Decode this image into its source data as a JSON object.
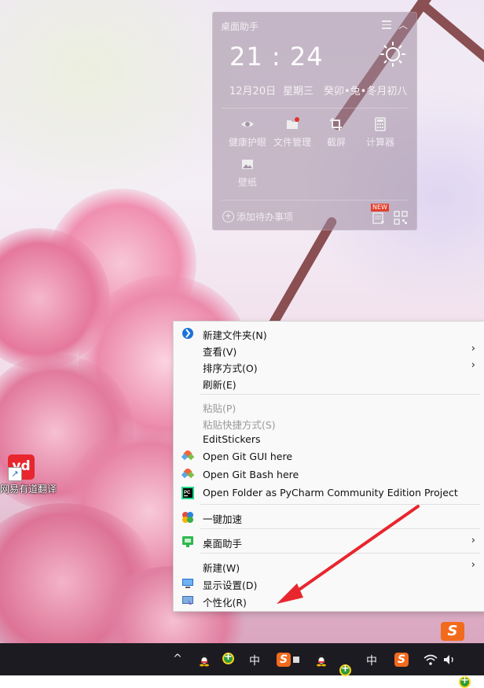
{
  "widget": {
    "title": "桌面助手",
    "time": "21 : 24",
    "date": "12月20日",
    "weekday": "星期三",
    "lunar": "癸卯•兔•冬月初八",
    "tools": [
      {
        "label": "健康护眼",
        "icon": "eye-icon"
      },
      {
        "label": "文件管理",
        "icon": "folder-icon"
      },
      {
        "label": "截屏",
        "icon": "crop-icon"
      },
      {
        "label": "计算器",
        "icon": "calculator-icon"
      },
      {
        "label": "壁纸",
        "icon": "image-icon"
      }
    ],
    "add_todo": "添加待办事项",
    "new_badge": "NEW"
  },
  "desktop_icon": {
    "label": "网易有道翻译",
    "icon_text": "yd"
  },
  "context_menu": {
    "items": [
      {
        "label": "新建文件夹(N)",
        "icon": "new-folder-icon"
      },
      {
        "label": "查看(V)",
        "submenu": true
      },
      {
        "label": "排序方式(O)",
        "submenu": true
      },
      {
        "label": "刷新(E)"
      },
      {
        "label": "粘贴(P)",
        "disabled": true
      },
      {
        "label": "粘贴快捷方式(S)",
        "disabled": true
      },
      {
        "label": "EditStickers"
      },
      {
        "label": "Open Git GUI here",
        "icon": "git-icon"
      },
      {
        "label": "Open Git Bash here",
        "icon": "git-icon"
      },
      {
        "label": "Open Folder as PyCharm Community Edition Project",
        "icon": "pycharm-icon"
      },
      {
        "label": "一键加速",
        "icon": "accelerate-icon"
      },
      {
        "label": "桌面助手",
        "icon": "desktop-helper-icon",
        "submenu": true
      },
      {
        "label": "新建(W)",
        "submenu": true
      },
      {
        "label": "显示设置(D)",
        "icon": "display-settings-icon"
      },
      {
        "label": "个性化(R)",
        "icon": "personalize-icon"
      }
    ],
    "submenu_arrow": "›"
  },
  "taskbar": {
    "show_hidden": "^",
    "ime_lang": "中",
    "sogou": "S",
    "ime_lang_2": "中",
    "sogou_2": "S"
  },
  "colors": {
    "annotation_arrow": "#e8262e",
    "widget_bg": "rgba(160,140,160,0.55)",
    "taskbar": "#1d1b22"
  }
}
